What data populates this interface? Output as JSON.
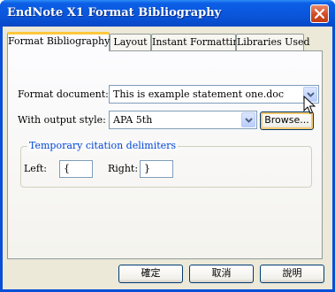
{
  "window": {
    "title": "EndNote X1 Format Bibliography"
  },
  "tabs": [
    {
      "label": "Format Bibliography",
      "active": true
    },
    {
      "label": "Layout",
      "active": false
    },
    {
      "label": "Instant Formatting",
      "active": false
    },
    {
      "label": "Libraries Used",
      "active": false
    }
  ],
  "form": {
    "format_document_label": "Format document:",
    "format_document_value": "This is example statement one.doc",
    "output_style_label": "With output style:",
    "output_style_value": "APA 5th",
    "browse_label": "Browse..."
  },
  "delimiters": {
    "group_title": "Temporary citation delimiters",
    "left_label": "Left:",
    "left_value": "{",
    "right_label": "Right:",
    "right_value": "}"
  },
  "buttons": {
    "ok": "確定",
    "cancel": "取消",
    "help": "說明"
  },
  "icons": {
    "close": "close-icon",
    "dropdown": "chevron-down-icon",
    "cursor": "mouse-pointer-icon"
  },
  "colors": {
    "title_bar": "#0a56dc",
    "close_button": "#d24a22",
    "group_title": "#0046d5",
    "active_tab_highlight": "#ffc83c"
  }
}
